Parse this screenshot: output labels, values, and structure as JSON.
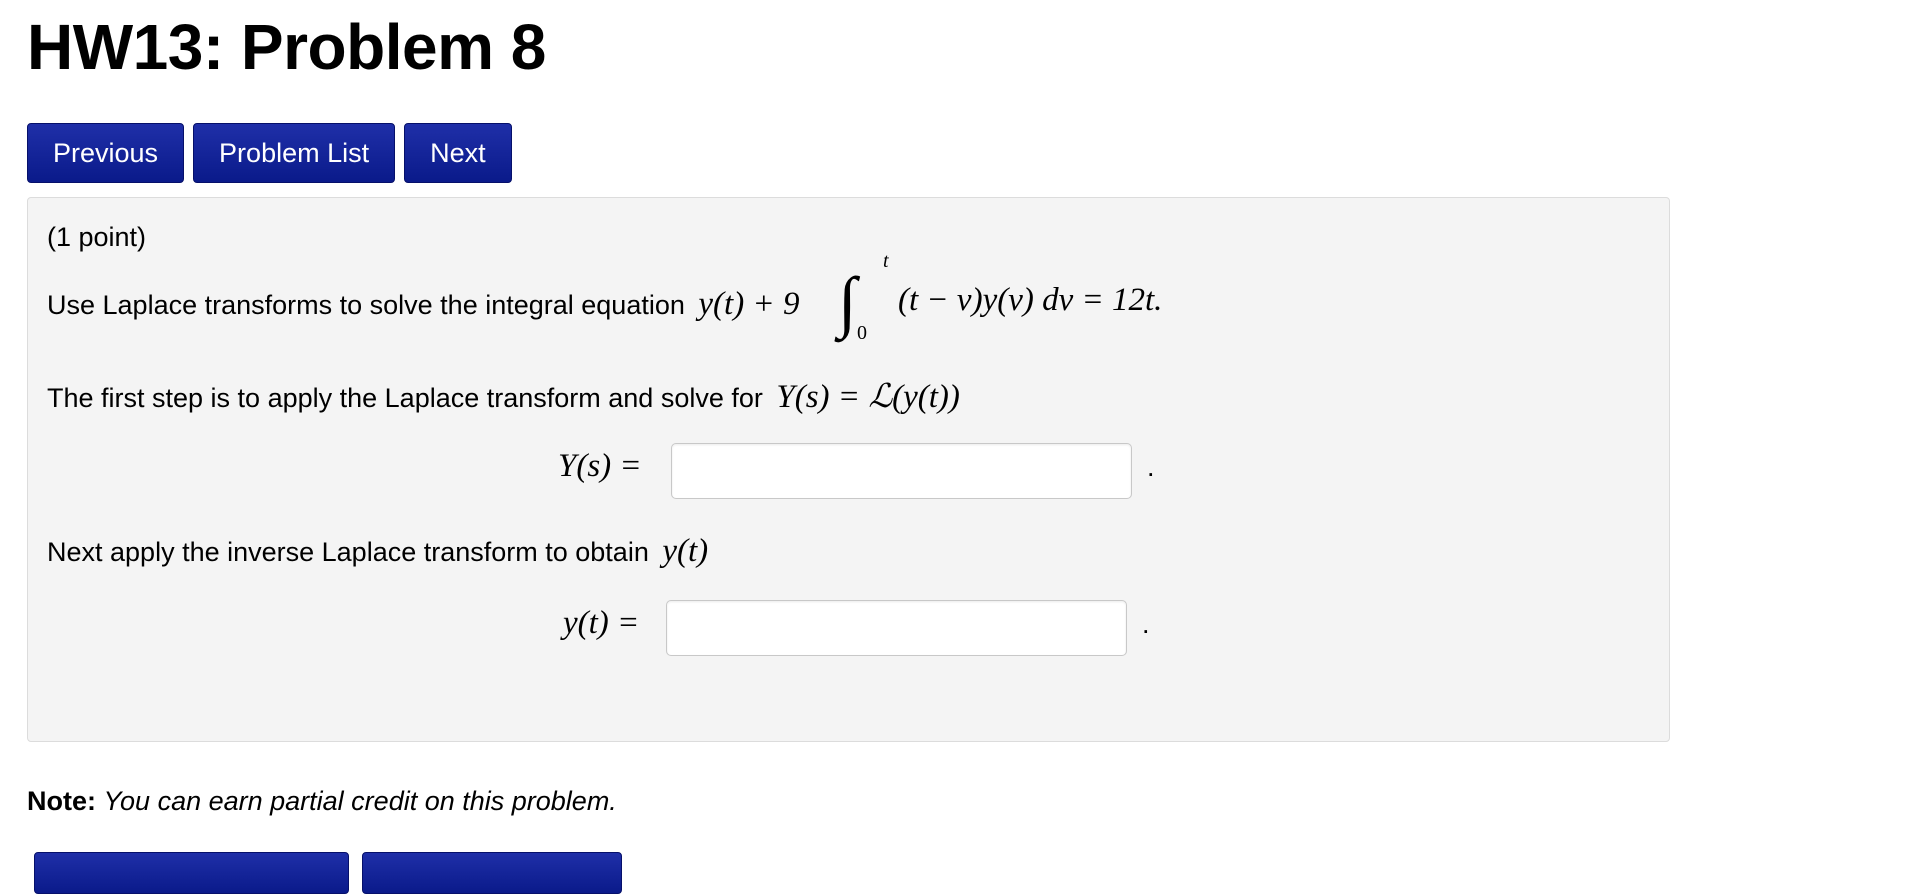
{
  "page": {
    "title": "HW13: Problem 8"
  },
  "nav": {
    "previous": "Previous",
    "problem_list": "Problem List",
    "next": "Next"
  },
  "problem": {
    "points": "(1 point)",
    "intro": "Use Laplace transforms to solve the integral equation",
    "equation": {
      "lhs": "y(t) + 9",
      "integral_sign": "∫",
      "upper_limit": "t",
      "lower_limit": "0",
      "integrand": "(t − v)y(v) dv = 12t."
    },
    "step1_text": "The first step is to apply the Laplace transform and solve for",
    "step1_math": "Y(s) = ℒ(y(t))",
    "answer1_label": "Y(s) =",
    "answer1_value": "",
    "step2_text": "Next apply the inverse Laplace transform to obtain",
    "step2_math": "y(t)",
    "answer2_label": "y(t) =",
    "answer2_value": "",
    "period": "."
  },
  "note": {
    "label": "Note:",
    "text": "You can earn partial credit on this problem."
  }
}
